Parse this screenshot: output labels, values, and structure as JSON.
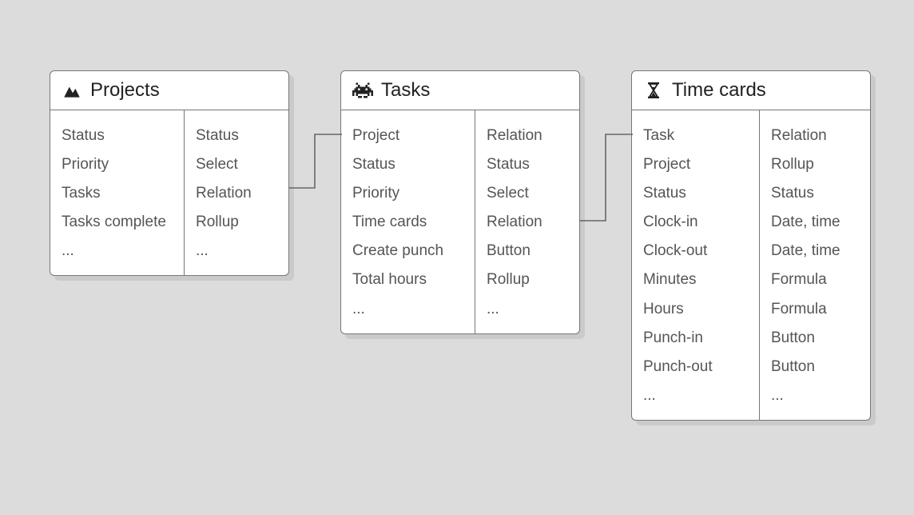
{
  "entities": {
    "projects": {
      "title": "Projects",
      "fields": [
        {
          "name": "Status",
          "type": "Status"
        },
        {
          "name": "Priority",
          "type": "Select"
        },
        {
          "name": "Tasks",
          "type": "Relation"
        },
        {
          "name": "Tasks complete",
          "type": "Rollup"
        },
        {
          "name": "...",
          "type": "..."
        }
      ]
    },
    "tasks": {
      "title": "Tasks",
      "fields": [
        {
          "name": "Project",
          "type": "Relation"
        },
        {
          "name": "Status",
          "type": "Status"
        },
        {
          "name": "Priority",
          "type": "Select"
        },
        {
          "name": "Time cards",
          "type": "Relation"
        },
        {
          "name": "Create punch",
          "type": "Button"
        },
        {
          "name": "Total hours",
          "type": "Rollup"
        },
        {
          "name": "...",
          "type": "..."
        }
      ]
    },
    "timecards": {
      "title": "Time cards",
      "fields": [
        {
          "name": "Task",
          "type": "Relation"
        },
        {
          "name": "Project",
          "type": "Rollup"
        },
        {
          "name": "Status",
          "type": "Status"
        },
        {
          "name": "Clock-in",
          "type": "Date, time"
        },
        {
          "name": "Clock-out",
          "type": "Date, time"
        },
        {
          "name": "Minutes",
          "type": "Formula"
        },
        {
          "name": "Hours",
          "type": "Formula"
        },
        {
          "name": "Punch-in",
          "type": "Button"
        },
        {
          "name": "Punch-out",
          "type": "Button"
        },
        {
          "name": "...",
          "type": "..."
        }
      ]
    }
  }
}
